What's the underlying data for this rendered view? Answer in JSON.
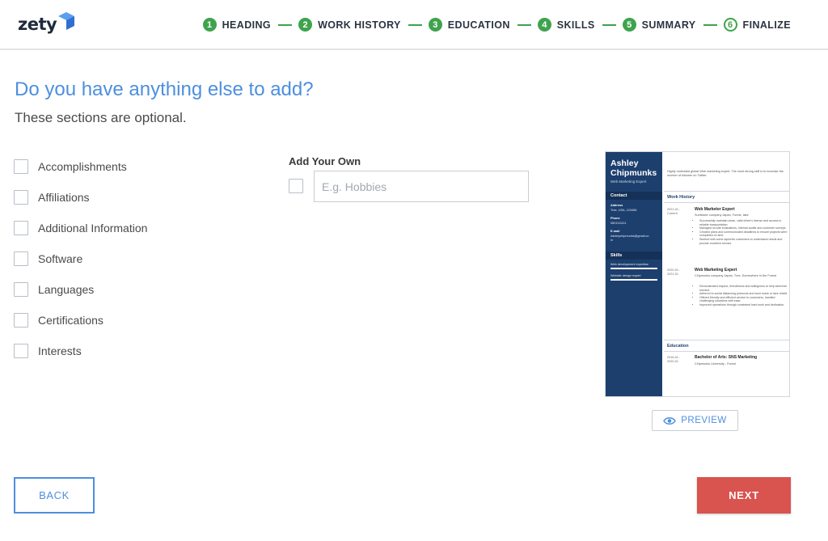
{
  "brand": {
    "name": "zety"
  },
  "steps": [
    {
      "num": "1",
      "label": "HEADING"
    },
    {
      "num": "2",
      "label": "WORK HISTORY"
    },
    {
      "num": "3",
      "label": "EDUCATION"
    },
    {
      "num": "4",
      "label": "SKILLS"
    },
    {
      "num": "5",
      "label": "SUMMARY"
    },
    {
      "num": "6",
      "label": "FINALIZE"
    }
  ],
  "page": {
    "title": "Do you have anything else to add?",
    "subtitle": "These sections are optional."
  },
  "sections": [
    {
      "label": "Accomplishments"
    },
    {
      "label": "Affiliations"
    },
    {
      "label": "Additional Information"
    },
    {
      "label": "Software"
    },
    {
      "label": "Languages"
    },
    {
      "label": "Certifications"
    },
    {
      "label": "Interests"
    }
  ],
  "add_own": {
    "title": "Add Your Own",
    "placeholder": "E.g. Hobbies",
    "value": ""
  },
  "resume": {
    "name_line1": "Ashley",
    "name_line2": "Chipmunks",
    "job_title": "Web Marketing Expert",
    "contact_heading": "Contact",
    "address_label": "Address",
    "address_value": "Tree, USA, 123456",
    "phone_label": "Phone",
    "phone_value": "0801111111",
    "email_label": "E-mail",
    "email_value1": "Ashleychipmunks@gmail.co",
    "email_value2": "m",
    "skills_heading": "Skills",
    "skill1": "Web development expertise",
    "skill2": "Website design expert",
    "summary": "Highly motivated global Web marketing expert. The most strong skill is to increase the number of follower on Twitter.",
    "work_heading": "Work History",
    "job1_date1": "2021-01 -",
    "job1_date2": "Current",
    "job1_title": "Web Marketer Expert",
    "job1_company": "Sunflower company Japan, Forest, lake",
    "job1_b1": "Successfully maintain clean, valid driver's license and access to reliable transportation.",
    "job1_b2": "Managed on-site evaluations, internal audits and customer surveys.",
    "job1_b3": "Created plans and communicated deadlines to ensure projects were completed on time.",
    "job1_b4": "Worked with some squirrels customers to understand needs and provide excellent service.",
    "job2_date1": "2020-01 -",
    "job2_date2": "2021-01",
    "job2_title": "Web Marketing Expert",
    "job2_company": "Chipmunks company Japan, Tree, Somewhere in the Forest",
    "job2_b1": "Demonstrated respect, friendliness and willingness to help wherever needed.",
    "job2_b2": "Adhered to social distancing protocols and wore mask or face shield.",
    "job2_b3": "Offered friendly and efficient service to customers, handled challenging situations with ease.",
    "job2_b4": "Improved operations through consistent hard work and dedication.",
    "edu_heading": "Education",
    "edu_date1": "2016-01 -",
    "edu_date2": "2020-01",
    "edu_degree": "Bachelor of Arts: SNS Marketing",
    "edu_school": "Chipmunks University - Forest"
  },
  "buttons": {
    "preview": "PREVIEW",
    "back": "BACK",
    "next": "NEXT"
  },
  "colors": {
    "accent": "#4d8fde",
    "step_green": "#3fa34d",
    "next_red": "#d9534f",
    "resume_sidebar": "#1d3f6e"
  }
}
